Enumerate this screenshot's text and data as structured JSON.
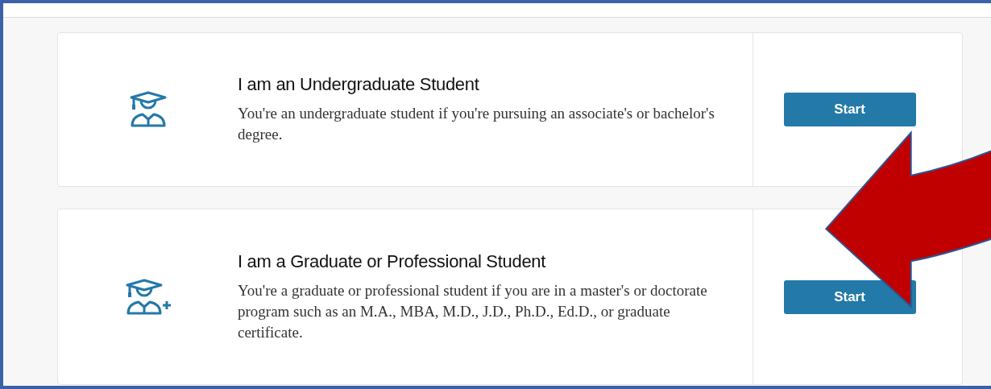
{
  "options": [
    {
      "kind": "undergraduate",
      "title": "I am an Undergraduate Student",
      "description": "You're an undergraduate student if you're pursuing an associate's or bachelor's degree.",
      "button": "Start"
    },
    {
      "kind": "graduate",
      "title": "I am a Graduate or Professional Student",
      "description": "You're a graduate or professional student if you are in a master's or doctorate program such as an M.A., MBA, M.D., J.D., Ph.D., Ed.D., or graduate certificate.",
      "button": "Start"
    }
  ]
}
